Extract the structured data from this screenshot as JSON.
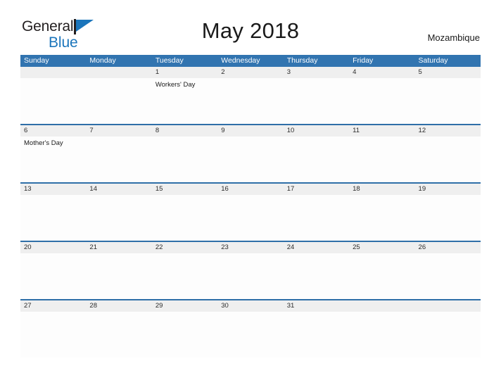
{
  "logo": {
    "word1": "General",
    "word2": "Blue",
    "icon": "flag-icon",
    "colors": {
      "dark": "#231f20",
      "blue": "#1b75bb"
    }
  },
  "header": {
    "title": "May 2018",
    "region": "Mozambique"
  },
  "theme": {
    "header_blue": "#3174b0",
    "divider_blue": "#2f6fa8",
    "date_band_gray": "#efefef",
    "page_background": "#ffffff"
  },
  "calendar": {
    "weekdays": [
      "Sunday",
      "Monday",
      "Tuesday",
      "Wednesday",
      "Thursday",
      "Friday",
      "Saturday"
    ],
    "weeks": [
      [
        {
          "day": "",
          "event": ""
        },
        {
          "day": "",
          "event": ""
        },
        {
          "day": "1",
          "event": "Workers' Day"
        },
        {
          "day": "2",
          "event": ""
        },
        {
          "day": "3",
          "event": ""
        },
        {
          "day": "4",
          "event": ""
        },
        {
          "day": "5",
          "event": ""
        }
      ],
      [
        {
          "day": "6",
          "event": "Mother's Day"
        },
        {
          "day": "7",
          "event": ""
        },
        {
          "day": "8",
          "event": ""
        },
        {
          "day": "9",
          "event": ""
        },
        {
          "day": "10",
          "event": ""
        },
        {
          "day": "11",
          "event": ""
        },
        {
          "day": "12",
          "event": ""
        }
      ],
      [
        {
          "day": "13",
          "event": ""
        },
        {
          "day": "14",
          "event": ""
        },
        {
          "day": "15",
          "event": ""
        },
        {
          "day": "16",
          "event": ""
        },
        {
          "day": "17",
          "event": ""
        },
        {
          "day": "18",
          "event": ""
        },
        {
          "day": "19",
          "event": ""
        }
      ],
      [
        {
          "day": "20",
          "event": ""
        },
        {
          "day": "21",
          "event": ""
        },
        {
          "day": "22",
          "event": ""
        },
        {
          "day": "23",
          "event": ""
        },
        {
          "day": "24",
          "event": ""
        },
        {
          "day": "25",
          "event": ""
        },
        {
          "day": "26",
          "event": ""
        }
      ],
      [
        {
          "day": "27",
          "event": ""
        },
        {
          "day": "28",
          "event": ""
        },
        {
          "day": "29",
          "event": ""
        },
        {
          "day": "30",
          "event": ""
        },
        {
          "day": "31",
          "event": ""
        },
        {
          "day": "",
          "event": ""
        },
        {
          "day": "",
          "event": ""
        }
      ]
    ]
  }
}
